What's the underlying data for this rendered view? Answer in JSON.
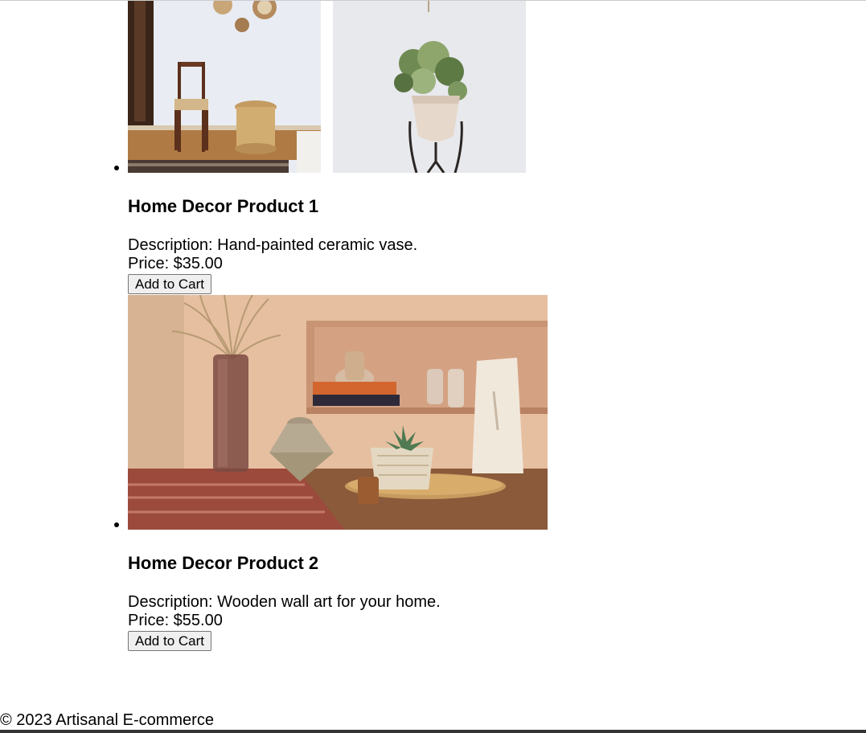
{
  "products": [
    {
      "title": "Home Decor Product 1",
      "description": "Description: Hand-painted ceramic vase.",
      "price": "Price: $35.00",
      "button_label": "Add to Cart",
      "image_left": "living room with wooden chair and rattan stool",
      "image_right": "potted plant on metal stand"
    },
    {
      "title": "Home Decor Product 2",
      "description": "Description: Wooden wall art for your home.",
      "price": "Price: $55.00",
      "button_label": "Add to Cart",
      "image": "ceramic vases, succulent and dried pampas grass on a wooden table"
    }
  ],
  "footer": {
    "text": "© 2023 Artisanal E-commerce"
  }
}
